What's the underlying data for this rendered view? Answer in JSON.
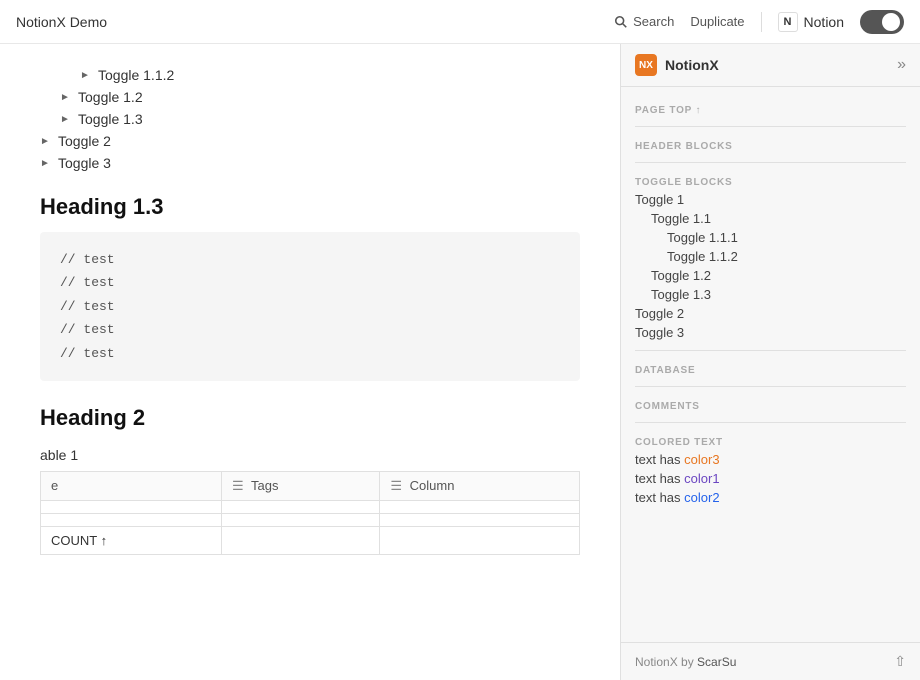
{
  "topbar": {
    "title": "NotionX Demo",
    "search_label": "Search",
    "duplicate_label": "Duplicate",
    "notion_label": "Notion"
  },
  "content": {
    "toggles": [
      {
        "label": "Toggle 1.1.2",
        "indent": 2
      },
      {
        "label": "Toggle 1.2",
        "indent": 1
      },
      {
        "label": "Toggle 1.3",
        "indent": 1
      },
      {
        "label": "Toggle 2",
        "indent": 0
      },
      {
        "label": "Toggle 3",
        "indent": 0
      }
    ],
    "heading_1_3": "Heading 1.3",
    "code_lines": [
      "// test",
      "// test",
      "// test",
      "// test",
      "// test"
    ],
    "heading_2": "Heading 2",
    "table_label": "able 1",
    "table_headers": [
      "e",
      "Tags",
      "Column"
    ],
    "table_rows": [
      [
        "",
        "",
        ""
      ],
      [
        "",
        "",
        ""
      ],
      [
        "COUNT ↑",
        "",
        ""
      ]
    ]
  },
  "sidebar": {
    "title": "NotionX",
    "sections": {
      "page_top": "PAGE TOP ↑",
      "header_blocks": "HEADER BLOCKS",
      "toggle_blocks": "TOGGLE BLOCKS",
      "database": "DATABASE",
      "comments": "COMMENTS",
      "colored_text": "COLORED TEXT"
    },
    "toggle_items": [
      {
        "label": "Toggle 1",
        "indent": 0
      },
      {
        "label": "Toggle 1.1",
        "indent": 1
      },
      {
        "label": "Toggle 1.1.1",
        "indent": 2
      },
      {
        "label": "Toggle 1.1.2",
        "indent": 2
      },
      {
        "label": "Toggle 1.2",
        "indent": 1
      },
      {
        "label": "Toggle 1.3",
        "indent": 1
      },
      {
        "label": "Toggle 2",
        "indent": 0
      },
      {
        "label": "Toggle 3",
        "indent": 0
      }
    ],
    "colored_items": [
      {
        "text": "text has ",
        "color_word": "color3",
        "color_class": "colored-orange"
      },
      {
        "text": "text has ",
        "color_word": "color1",
        "color_class": "colored-purple"
      },
      {
        "text": "text has ",
        "color_word": "color2",
        "color_class": "colored-blue"
      }
    ],
    "footer_text": "NotionX by ",
    "footer_author": "ScarSu"
  }
}
